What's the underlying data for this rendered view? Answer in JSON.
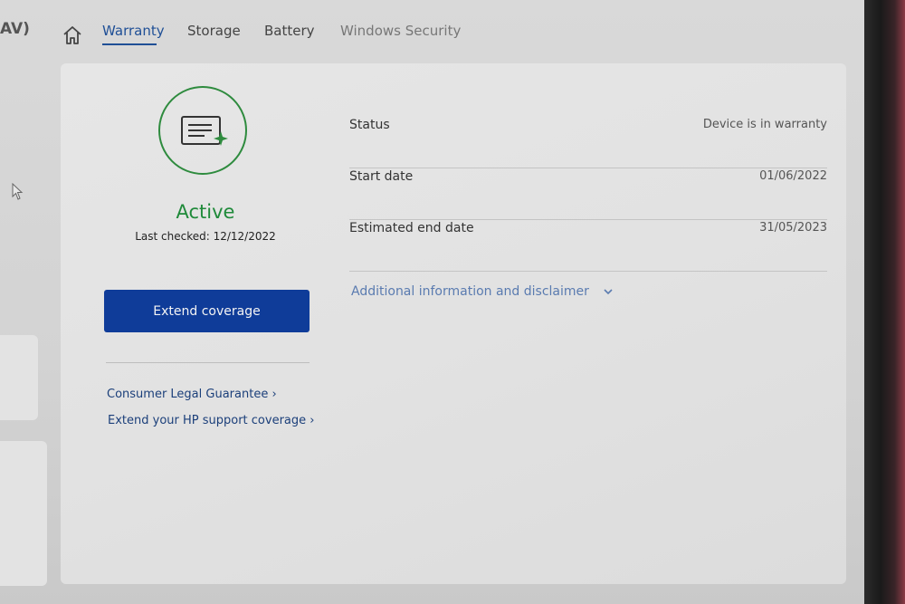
{
  "app": {
    "title_fragment": "AV)"
  },
  "nav": {
    "tabs": [
      {
        "label": "Warranty",
        "active": true
      },
      {
        "label": "Storage",
        "active": false
      },
      {
        "label": "Battery",
        "active": false
      },
      {
        "label": "Windows Security",
        "active": false
      }
    ]
  },
  "warranty": {
    "status": "Active",
    "last_checked": "Last checked: 12/12/2022",
    "extend_button": "Extend coverage",
    "links": [
      "Consumer Legal Guarantee ›",
      "Extend your HP support coverage ›"
    ],
    "details": [
      {
        "label": "Status",
        "value": "Device is in warranty"
      },
      {
        "label": "Start date",
        "value": "01/06/2022"
      },
      {
        "label": "Estimated end date",
        "value": "31/05/2023"
      }
    ],
    "disclaimer": "Additional information and disclaimer"
  },
  "colors": {
    "accent": "#1f4f96",
    "button": "#0f3c99",
    "active_green": "#1f8a3a",
    "link": "#1b3f7a"
  },
  "icons": [
    "home-icon",
    "warranty-certificate-icon",
    "chevron-down-icon",
    "mouse-cursor-icon"
  ]
}
